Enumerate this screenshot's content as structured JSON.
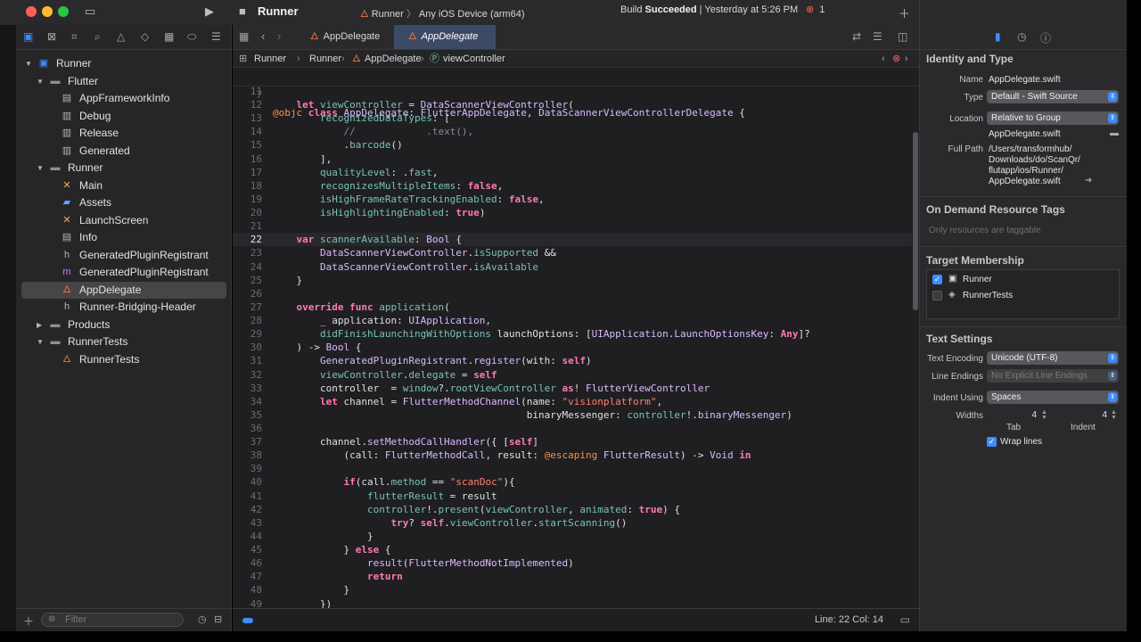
{
  "titlebar": {
    "scheme_title": "Runner",
    "scheme_target": "Runner",
    "destination": "Any iOS Device (arm64)",
    "build_prefix": "Build ",
    "build_result": "Succeeded",
    "build_time": " | Yesterday at 5:26 PM",
    "error_count": "1",
    "colors": {
      "close": "#ff5f57",
      "minimize": "#febc2e",
      "zoom": "#28c840"
    }
  },
  "navigator": {
    "filter_placeholder": "Filter",
    "tree": [
      {
        "label": "Runner",
        "icon": "app-icon",
        "depth": 0,
        "expanded": true
      },
      {
        "label": "Flutter",
        "icon": "folder-icon",
        "depth": 1,
        "expanded": true
      },
      {
        "label": "AppFrameworkInfo",
        "icon": "plist-icon",
        "depth": 2
      },
      {
        "label": "Debug",
        "icon": "xcconfig-icon",
        "depth": 2
      },
      {
        "label": "Release",
        "icon": "xcconfig-icon",
        "depth": 2
      },
      {
        "label": "Generated",
        "icon": "xcconfig-icon",
        "depth": 2
      },
      {
        "label": "Runner",
        "icon": "folder-icon",
        "depth": 1,
        "expanded": true
      },
      {
        "label": "Main",
        "icon": "storyboard-icon",
        "depth": 2
      },
      {
        "label": "Assets",
        "icon": "assets-icon",
        "depth": 2
      },
      {
        "label": "LaunchScreen",
        "icon": "storyboard-icon",
        "depth": 2
      },
      {
        "label": "Info",
        "icon": "plist-icon",
        "depth": 2
      },
      {
        "label": "GeneratedPluginRegistrant",
        "icon": "header-file-icon",
        "depth": 2
      },
      {
        "label": "GeneratedPluginRegistrant",
        "icon": "objc-file-icon",
        "depth": 2
      },
      {
        "label": "AppDelegate",
        "icon": "swift-file-icon",
        "depth": 2,
        "selected": true
      },
      {
        "label": "Runner-Bridging-Header",
        "icon": "header-file-icon",
        "depth": 2
      },
      {
        "label": "Products",
        "icon": "folder-icon",
        "depth": 1,
        "expanded": false
      },
      {
        "label": "RunnerTests",
        "icon": "folder-icon",
        "depth": 1,
        "expanded": true
      },
      {
        "label": "RunnerTests",
        "icon": "swift-file-icon",
        "depth": 2
      }
    ]
  },
  "editor": {
    "tabs": [
      {
        "label": "AppDelegate",
        "active": false
      },
      {
        "label": "AppDelegate",
        "active": true
      }
    ],
    "jumpbar": {
      "project": "Runner",
      "group": "Runner",
      "file": "AppDelegate",
      "symbol": "viewController"
    },
    "sticky": {
      "line": "7",
      "tokens": [
        {
          "t": "@objc ",
          "c": "a"
        },
        {
          "t": "class ",
          "c": "k"
        },
        {
          "t": "AppDelegate",
          "c": "t"
        },
        {
          "t": ": ",
          "c": ""
        },
        {
          "t": "FlutterAppDelegate",
          "c": "t"
        },
        {
          "t": ", ",
          "c": ""
        },
        {
          "t": "DataScannerViewControllerDelegate",
          "c": "t"
        },
        {
          "t": " {",
          "c": ""
        }
      ]
    },
    "current_line": 22,
    "lines": [
      {
        "n": "11",
        "tokens": []
      },
      {
        "n": "12",
        "tokens": [
          {
            "t": "    ",
            "c": ""
          },
          {
            "t": "let ",
            "c": "k"
          },
          {
            "t": "viewController",
            "c": "p"
          },
          {
            "t": " = ",
            "c": ""
          },
          {
            "t": "DataScannerViewController",
            "c": "t"
          },
          {
            "t": "(",
            "c": ""
          }
        ]
      },
      {
        "n": "13",
        "tokens": [
          {
            "t": "        ",
            "c": ""
          },
          {
            "t": "recognizedDataTypes",
            "c": "p"
          },
          {
            "t": ": [",
            "c": ""
          }
        ]
      },
      {
        "n": "14",
        "tokens": [
          {
            "t": "            ",
            "c": ""
          },
          {
            "t": "//            .text(),",
            "c": "c"
          }
        ]
      },
      {
        "n": "15",
        "tokens": [
          {
            "t": "            .",
            "c": ""
          },
          {
            "t": "barcode",
            "c": "p"
          },
          {
            "t": "()",
            "c": ""
          }
        ]
      },
      {
        "n": "16",
        "tokens": [
          {
            "t": "        ],",
            "c": ""
          }
        ]
      },
      {
        "n": "17",
        "tokens": [
          {
            "t": "        ",
            "c": ""
          },
          {
            "t": "qualityLevel",
            "c": "p"
          },
          {
            "t": ": .",
            "c": ""
          },
          {
            "t": "fast",
            "c": "p"
          },
          {
            "t": ",",
            "c": ""
          }
        ]
      },
      {
        "n": "18",
        "tokens": [
          {
            "t": "        ",
            "c": ""
          },
          {
            "t": "recognizesMultipleItems",
            "c": "p"
          },
          {
            "t": ": ",
            "c": ""
          },
          {
            "t": "false",
            "c": "k"
          },
          {
            "t": ",",
            "c": ""
          }
        ]
      },
      {
        "n": "19",
        "tokens": [
          {
            "t": "        ",
            "c": ""
          },
          {
            "t": "isHighFrameRateTrackingEnabled",
            "c": "p"
          },
          {
            "t": ": ",
            "c": ""
          },
          {
            "t": "false",
            "c": "k"
          },
          {
            "t": ",",
            "c": ""
          }
        ]
      },
      {
        "n": "20",
        "tokens": [
          {
            "t": "        ",
            "c": ""
          },
          {
            "t": "isHighlightingEnabled",
            "c": "p"
          },
          {
            "t": ": ",
            "c": ""
          },
          {
            "t": "true",
            "c": "k"
          },
          {
            "t": ")",
            "c": ""
          }
        ]
      },
      {
        "n": "21",
        "tokens": []
      },
      {
        "n": "22",
        "tokens": [
          {
            "t": "    ",
            "c": ""
          },
          {
            "t": "var ",
            "c": "k"
          },
          {
            "t": "scannerAvailable",
            "c": "p"
          },
          {
            "t": ": ",
            "c": ""
          },
          {
            "t": "Bool",
            "c": "t"
          },
          {
            "t": " {",
            "c": ""
          }
        ]
      },
      {
        "n": "23",
        "tokens": [
          {
            "t": "        ",
            "c": ""
          },
          {
            "t": "DataScannerViewController",
            "c": "t"
          },
          {
            "t": ".",
            "c": ""
          },
          {
            "t": "isSupported",
            "c": "p"
          },
          {
            "t": " &&",
            "c": ""
          }
        ]
      },
      {
        "n": "24",
        "tokens": [
          {
            "t": "        ",
            "c": ""
          },
          {
            "t": "DataScannerViewController",
            "c": "t"
          },
          {
            "t": ".",
            "c": ""
          },
          {
            "t": "isAvailable",
            "c": "p"
          }
        ]
      },
      {
        "n": "25",
        "tokens": [
          {
            "t": "    }",
            "c": ""
          }
        ]
      },
      {
        "n": "26",
        "tokens": []
      },
      {
        "n": "27",
        "tokens": [
          {
            "t": "    ",
            "c": ""
          },
          {
            "t": "override ",
            "c": "k"
          },
          {
            "t": "func ",
            "c": "k"
          },
          {
            "t": "application",
            "c": "p"
          },
          {
            "t": "(",
            "c": ""
          }
        ]
      },
      {
        "n": "28",
        "tokens": [
          {
            "t": "        _ application: ",
            "c": ""
          },
          {
            "t": "UIApplication",
            "c": "t"
          },
          {
            "t": ",",
            "c": ""
          }
        ]
      },
      {
        "n": "29",
        "tokens": [
          {
            "t": "        ",
            "c": ""
          },
          {
            "t": "didFinishLaunchingWithOptions",
            "c": "p"
          },
          {
            "t": " launchOptions: [",
            "c": ""
          },
          {
            "t": "UIApplication",
            "c": "t"
          },
          {
            "t": ".",
            "c": ""
          },
          {
            "t": "LaunchOptionsKey",
            "c": "t"
          },
          {
            "t": ": ",
            "c": ""
          },
          {
            "t": "Any",
            "c": "k"
          },
          {
            "t": "]?",
            "c": ""
          }
        ]
      },
      {
        "n": "30",
        "tokens": [
          {
            "t": "    ) -> ",
            "c": ""
          },
          {
            "t": "Bool",
            "c": "t"
          },
          {
            "t": " {",
            "c": ""
          }
        ]
      },
      {
        "n": "31",
        "tokens": [
          {
            "t": "        ",
            "c": ""
          },
          {
            "t": "GeneratedPluginRegistrant",
            "c": "t"
          },
          {
            "t": ".",
            "c": ""
          },
          {
            "t": "register",
            "c": "t"
          },
          {
            "t": "(with: ",
            "c": ""
          },
          {
            "t": "self",
            "c": "k"
          },
          {
            "t": ")",
            "c": ""
          }
        ]
      },
      {
        "n": "32",
        "tokens": [
          {
            "t": "        ",
            "c": ""
          },
          {
            "t": "viewController",
            "c": "p"
          },
          {
            "t": ".",
            "c": ""
          },
          {
            "t": "delegate",
            "c": "p"
          },
          {
            "t": " = ",
            "c": ""
          },
          {
            "t": "self",
            "c": "k"
          }
        ]
      },
      {
        "n": "33",
        "tokens": [
          {
            "t": "        controller  = ",
            "c": ""
          },
          {
            "t": "window",
            "c": "p"
          },
          {
            "t": "?.",
            "c": ""
          },
          {
            "t": "rootViewController",
            "c": "p"
          },
          {
            "t": " ",
            "c": ""
          },
          {
            "t": "as",
            "c": "k"
          },
          {
            "t": "! ",
            "c": ""
          },
          {
            "t": "FlutterViewController",
            "c": "t"
          }
        ]
      },
      {
        "n": "34",
        "tokens": [
          {
            "t": "        ",
            "c": ""
          },
          {
            "t": "let ",
            "c": "k"
          },
          {
            "t": "channel = ",
            "c": ""
          },
          {
            "t": "FlutterMethodChannel",
            "c": "t"
          },
          {
            "t": "(name: ",
            "c": ""
          },
          {
            "t": "\"visionplatform\"",
            "c": "s"
          },
          {
            "t": ",",
            "c": ""
          }
        ]
      },
      {
        "n": "35",
        "tokens": [
          {
            "t": "                                           binaryMessenger: ",
            "c": ""
          },
          {
            "t": "controller",
            "c": "p"
          },
          {
            "t": "!.",
            "c": ""
          },
          {
            "t": "binaryMessenger",
            "c": "t"
          },
          {
            "t": ")",
            "c": ""
          }
        ]
      },
      {
        "n": "36",
        "tokens": []
      },
      {
        "n": "37",
        "tokens": [
          {
            "t": "        channel.",
            "c": ""
          },
          {
            "t": "setMethodCallHandler",
            "c": "t"
          },
          {
            "t": "({ [",
            "c": ""
          },
          {
            "t": "self",
            "c": "k"
          },
          {
            "t": "]",
            "c": ""
          }
        ]
      },
      {
        "n": "38",
        "tokens": [
          {
            "t": "            (call: ",
            "c": ""
          },
          {
            "t": "FlutterMethodCall",
            "c": "t"
          },
          {
            "t": ", result: ",
            "c": ""
          },
          {
            "t": "@escaping",
            "c": "a"
          },
          {
            "t": " ",
            "c": ""
          },
          {
            "t": "FlutterResult",
            "c": "t"
          },
          {
            "t": ") -> ",
            "c": ""
          },
          {
            "t": "Void",
            "c": "t"
          },
          {
            "t": " ",
            "c": ""
          },
          {
            "t": "in",
            "c": "k"
          }
        ]
      },
      {
        "n": "39",
        "tokens": []
      },
      {
        "n": "40",
        "tokens": [
          {
            "t": "            ",
            "c": ""
          },
          {
            "t": "if",
            "c": "k"
          },
          {
            "t": "(call.",
            "c": ""
          },
          {
            "t": "method",
            "c": "p"
          },
          {
            "t": " == ",
            "c": ""
          },
          {
            "t": "\"scanDoc\"",
            "c": "s"
          },
          {
            "t": "){",
            "c": ""
          }
        ]
      },
      {
        "n": "41",
        "tokens": [
          {
            "t": "                ",
            "c": ""
          },
          {
            "t": "flutterResult",
            "c": "p"
          },
          {
            "t": " = result",
            "c": ""
          }
        ]
      },
      {
        "n": "42",
        "tokens": [
          {
            "t": "                ",
            "c": ""
          },
          {
            "t": "controller",
            "c": "p"
          },
          {
            "t": "!.",
            "c": ""
          },
          {
            "t": "present",
            "c": "p"
          },
          {
            "t": "(",
            "c": ""
          },
          {
            "t": "viewController",
            "c": "p"
          },
          {
            "t": ", ",
            "c": ""
          },
          {
            "t": "animated",
            "c": "p"
          },
          {
            "t": ": ",
            "c": ""
          },
          {
            "t": "true",
            "c": "k"
          },
          {
            "t": ") {",
            "c": ""
          }
        ]
      },
      {
        "n": "43",
        "tokens": [
          {
            "t": "                    ",
            "c": ""
          },
          {
            "t": "try",
            "c": "k"
          },
          {
            "t": "? ",
            "c": ""
          },
          {
            "t": "self",
            "c": "k"
          },
          {
            "t": ".",
            "c": ""
          },
          {
            "t": "viewController",
            "c": "p"
          },
          {
            "t": ".",
            "c": ""
          },
          {
            "t": "startScanning",
            "c": "p"
          },
          {
            "t": "()",
            "c": ""
          }
        ]
      },
      {
        "n": "44",
        "tokens": [
          {
            "t": "                }",
            "c": ""
          }
        ]
      },
      {
        "n": "45",
        "tokens": [
          {
            "t": "            } ",
            "c": ""
          },
          {
            "t": "else",
            "c": "k"
          },
          {
            "t": " {",
            "c": ""
          }
        ]
      },
      {
        "n": "46",
        "tokens": [
          {
            "t": "                ",
            "c": ""
          },
          {
            "t": "result",
            "c": "t"
          },
          {
            "t": "(",
            "c": ""
          },
          {
            "t": "FlutterMethodNotImplemented",
            "c": "t"
          },
          {
            "t": ")",
            "c": ""
          }
        ]
      },
      {
        "n": "47",
        "tokens": [
          {
            "t": "                ",
            "c": ""
          },
          {
            "t": "return",
            "c": "k"
          }
        ]
      },
      {
        "n": "48",
        "tokens": [
          {
            "t": "            }",
            "c": ""
          }
        ]
      },
      {
        "n": "49",
        "tokens": [
          {
            "t": "        })",
            "c": ""
          }
        ]
      }
    ],
    "status": {
      "cursor": "Line: 22  Col: 14"
    }
  },
  "inspector": {
    "identity": {
      "title": "Identity and Type",
      "name_label": "Name",
      "name_value": "AppDelegate.swift",
      "type_label": "Type",
      "type_value": "Default - Swift Source",
      "location_label": "Location",
      "location_value": "Relative to Group",
      "location_file": "AppDelegate.swift",
      "fullpath_label": "Full Path",
      "fullpath_lines": [
        "/Users/transformhub/",
        "Downloads/do/ScanQr/",
        "flutapp/ios/Runner/",
        "AppDelegate.swift"
      ]
    },
    "odr": {
      "title": "On Demand Resource Tags",
      "placeholder": "Only resources are taggable"
    },
    "membership": {
      "title": "Target Membership",
      "targets": [
        {
          "label": "Runner",
          "checked": true,
          "icon": "app-target-icon"
        },
        {
          "label": "RunnerTests",
          "checked": false,
          "icon": "test-target-icon"
        }
      ]
    },
    "text_settings": {
      "title": "Text Settings",
      "encoding_label": "Text Encoding",
      "encoding_value": "Unicode (UTF-8)",
      "endings_label": "Line Endings",
      "endings_value": "No Explicit Line Endings",
      "indent_label": "Indent Using",
      "indent_value": "Spaces",
      "widths_label": "Widths",
      "tab_width": "4",
      "indent_width": "4",
      "tab_label": "Tab",
      "indent_sublabel": "Indent",
      "wrap_label": "Wrap lines",
      "wrap_checked": true
    }
  }
}
